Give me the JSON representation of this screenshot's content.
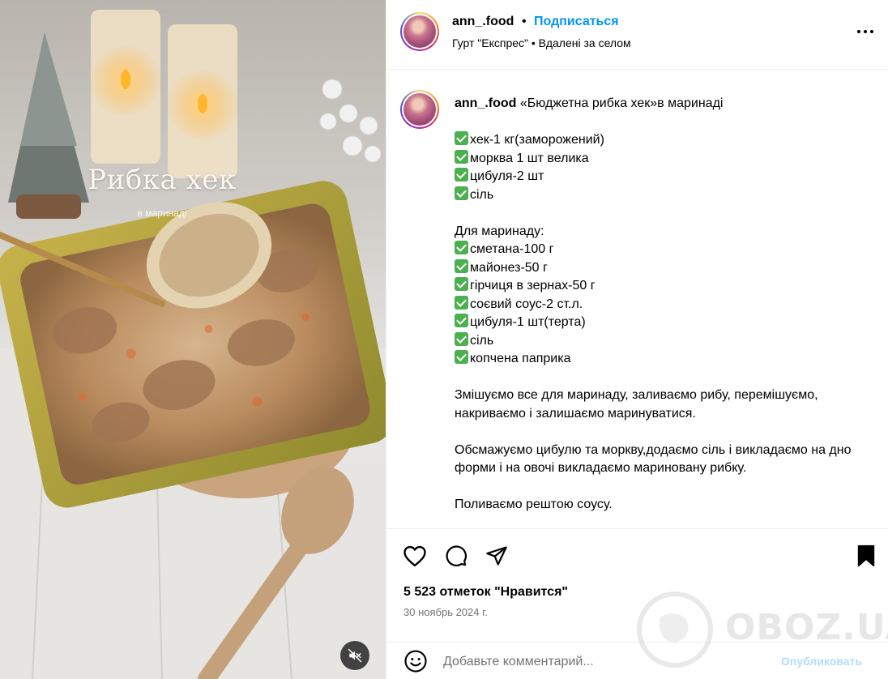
{
  "media": {
    "title": "Рибка хек",
    "subtitle": "в маринаді",
    "mute_icon": "speaker-muted-icon"
  },
  "header": {
    "username": "ann_.food",
    "separator": "•",
    "follow_label": "Подписаться",
    "subtitle": "Гурт \"Експрес\" • Вдалені за селом",
    "more_icon": "more-options-icon"
  },
  "caption": {
    "username": "ann_.food",
    "title": "«Бюджетна рибка хек»в маринаді",
    "ingredients": [
      "хек-1 кг(заморожений)",
      "морква 1 шт велика",
      "цибуля-2 шт",
      "сіль"
    ],
    "marinade_heading": "Для маринаду:",
    "marinade": [
      "сметана-100 г",
      "майонез-50 г",
      "гірчиця в зернах-50 г",
      "соєвий соус-2 ст.л.",
      "цибуля-1 шт(терта)",
      "сіль",
      "копчена паприка"
    ],
    "step1": "Змішуємо все для маринаду, заливаємо рибу, перемішуємо, накриваємо і залишаємо маринуватися.",
    "step2": "Обсмажуємо цибулю та моркву,додаємо сіль і викладаємо на дно форми і на овочі викладаємо мариновану рибку.",
    "step3": "Поливаємо рештою соусу."
  },
  "actions": {
    "like_icon": "heart-icon",
    "comment_icon": "comment-icon",
    "share_icon": "paper-plane-icon",
    "save_icon": "bookmark-icon",
    "likes_text": "5 523 отметок \"Нравится\"",
    "date": "30 ноябрь 2024 г."
  },
  "comment": {
    "placeholder": "Добавьте комментарий...",
    "publish_label": "Опубликовать",
    "emoji_icon": "emoji-icon"
  },
  "watermark": {
    "text": "OBOZ.UA"
  }
}
